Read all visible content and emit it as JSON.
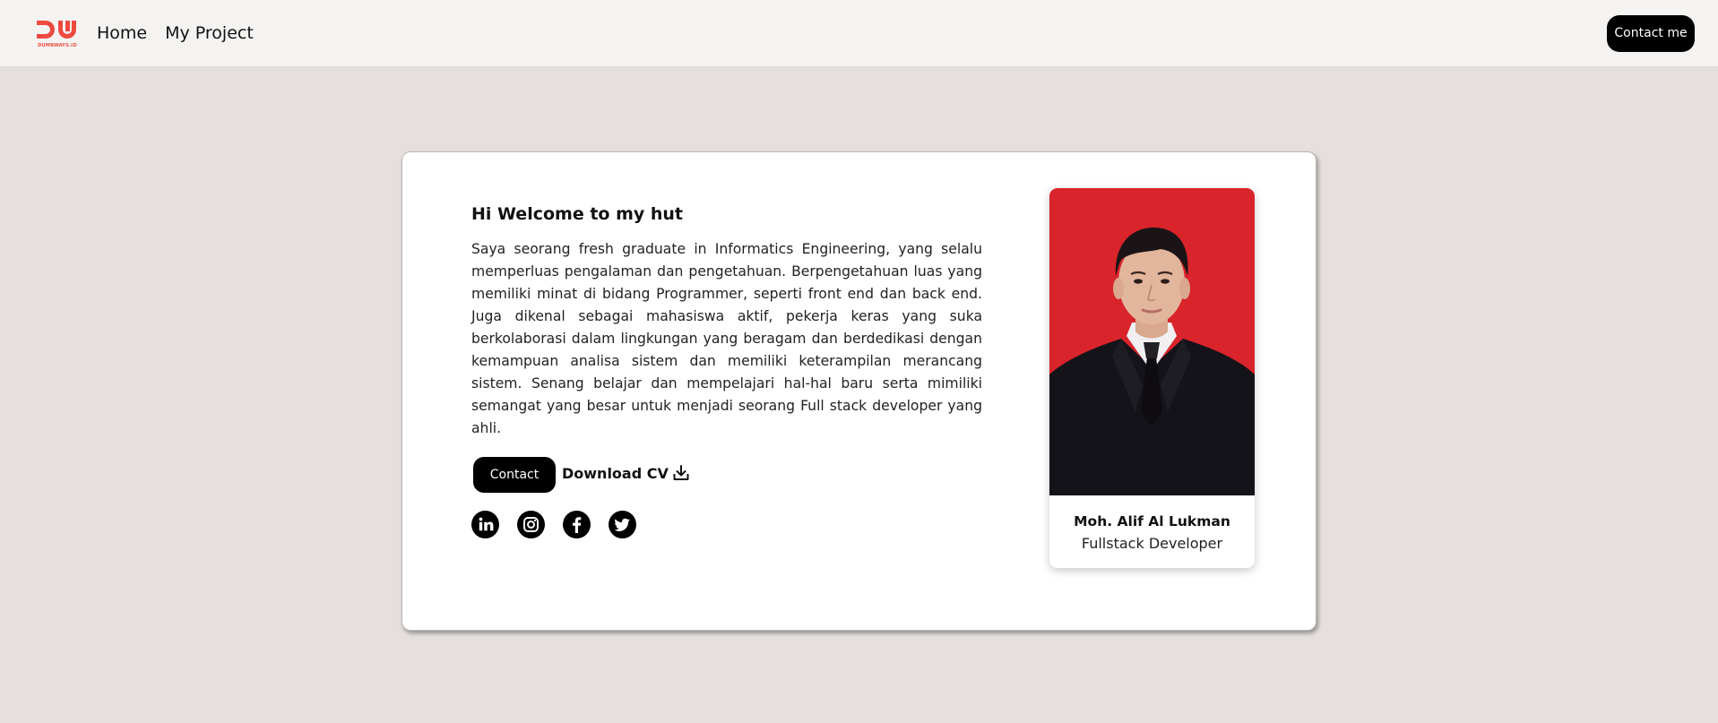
{
  "navbar": {
    "logo_text": "DUMBWAYS.ID",
    "links": [
      {
        "label": "Home"
      },
      {
        "label": "My Project"
      }
    ],
    "contact_button": "Contact me"
  },
  "intro": {
    "greeting": "Hi Welcome to my hut",
    "bio": "Saya seorang fresh graduate in Informatics Engineering, yang selalu memperluas pengalaman dan pengetahuan. Berpengetahuan luas yang memiliki minat di bidang Programmer, seperti front end dan back end. Juga dikenal sebagai mahasiswa aktif, pekerja keras yang suka berkolaborasi dalam lingkungan yang beragam dan berdedikasi dengan kemampuan analisa sistem dan memiliki keterampilan merancang sistem. Senang belajar dan mempelajari hal-hal baru serta mimiliki semangat yang besar untuk menjadi seorang Full stack developer yang ahli.",
    "contact_button": "Contact",
    "download_label": "Download CV"
  },
  "socials": [
    {
      "icon": "linkedin-icon"
    },
    {
      "icon": "instagram-icon"
    },
    {
      "icon": "facebook-icon"
    },
    {
      "icon": "twitter-icon"
    }
  ],
  "profile": {
    "name": "Moh. Alif Al Lukman",
    "role": "Fullstack Developer"
  },
  "colors": {
    "brand": "#ef4a3f",
    "page_bg": "#e5e0dd",
    "nav_bg": "#f4f3f1",
    "button": "#000000",
    "photo_bg": "#d8242a"
  }
}
